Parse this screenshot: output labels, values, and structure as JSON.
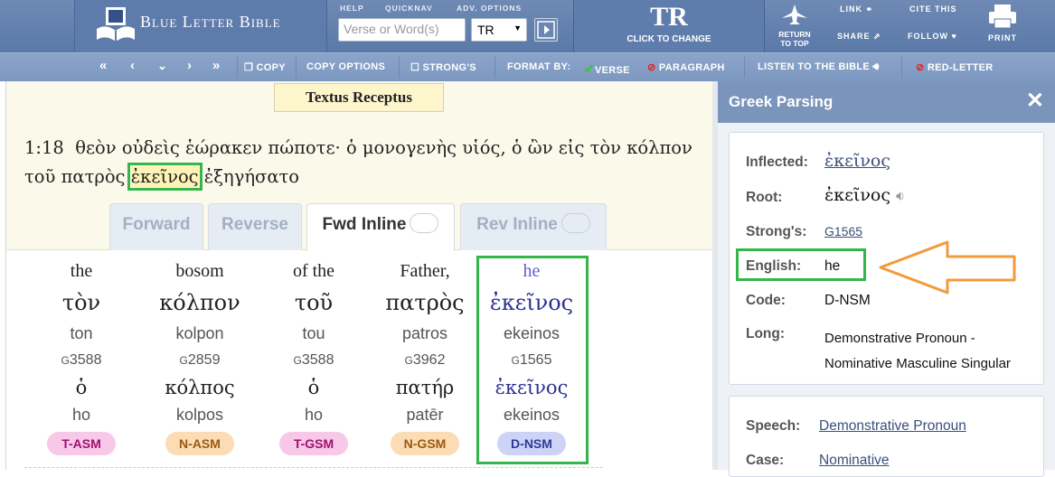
{
  "header": {
    "logo": "Blue Letter Bible",
    "help": "HELP",
    "quicknav": "QUICKNAV",
    "adv_options": "ADV. OPTIONS",
    "search_placeholder": "Verse or Word(s)",
    "version": "TR",
    "tr_big": "TR",
    "tr_small": "CLICK TO CHANGE",
    "return_top_1": "RETURN",
    "return_top_2": "TO TOP",
    "link": "LINK",
    "cite": "CITE THIS",
    "share": "SHARE",
    "follow": "FOLLOW",
    "print": "PRINT"
  },
  "toolbar": {
    "copy": "COPY",
    "copy_options": "COPY OPTIONS",
    "strongs": "STRONG'S",
    "format_by": "FORMAT BY:",
    "verse": "VERSE",
    "paragraph": "PARAGRAPH",
    "listen": "LISTEN TO THE BIBLE",
    "red_letter": "RED-LETTER"
  },
  "main": {
    "translation_tab": "Textus Receptus",
    "verse_ref": "1:18",
    "verse_before": "θεὸν οὐδεὶς ἑώρακεν πώποτε· ὁ μονογενὴς υἱός, ὁ ὢν εἰς τὸν κόλπον",
    "verse_line2_before": "τοῦ πατρὸς ",
    "verse_highlight": "ἐκεῖνος",
    "verse_after": " ἐξηγήσατο",
    "tabs": [
      "Forward",
      "Reverse",
      "Fwd Inline",
      "Rev Inline"
    ]
  },
  "words": [
    {
      "en": "the",
      "gk": "τὸν",
      "tl": "ton",
      "strong": "3588",
      "root": "ὁ",
      "root_tl": "ho",
      "code": "T-ASM"
    },
    {
      "en": "bosom",
      "gk": "κόλπον",
      "tl": "kolpon",
      "strong": "2859",
      "root": "κόλπος",
      "root_tl": "kolpos",
      "code": "N-ASM"
    },
    {
      "en": "of the",
      "gk": "τοῦ",
      "tl": "tou",
      "strong": "3588",
      "root": "ὁ",
      "root_tl": "ho",
      "code": "T-GSM"
    },
    {
      "en": "Father,",
      "gk": "πατρὸς",
      "tl": "patros",
      "strong": "3962",
      "root": "πατήρ",
      "root_tl": "patēr",
      "code": "N-GSM"
    },
    {
      "en": "he",
      "gk": "ἐκεῖνος",
      "tl": "ekeinos",
      "strong": "1565",
      "root": "ἐκεῖνος",
      "root_tl": "ekeinos",
      "code": "D-NSM"
    }
  ],
  "strong_prefix": "G",
  "badge_colors": {
    "T": {
      "bg": "#f8c8e8",
      "fg": "#a01070"
    },
    "N": {
      "bg": "#fbdcb4",
      "fg": "#9a5a10"
    },
    "D": {
      "bg": "#cdd3f6",
      "fg": "#2e3a9a"
    }
  },
  "panel": {
    "title": "Greek Parsing",
    "inflected_label": "Inflected:",
    "inflected": "ἐκεῖνος",
    "root_label": "Root:",
    "root": "ἐκεῖνος",
    "strongs_label": "Strong's:",
    "strongs": "G1565",
    "english_label": "English:",
    "english": "he",
    "code_label": "Code:",
    "code": "D-NSM",
    "long_label": "Long:",
    "long_1": "Demonstrative Pronoun -",
    "long_2": "Nominative Masculine Singular",
    "speech_label": "Speech:",
    "speech": "Demonstrative Pronoun",
    "case_label": "Case:",
    "case": "Nominative"
  },
  "colors": {
    "highlight_green": "#34b64b",
    "arrow_orange": "#f39a3c"
  }
}
